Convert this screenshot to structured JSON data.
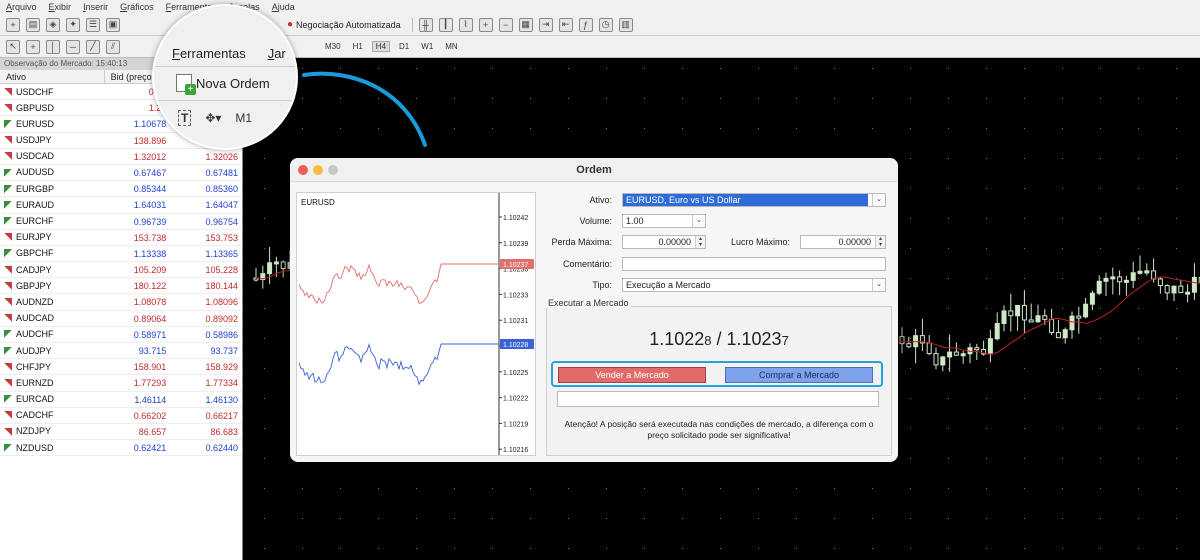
{
  "menu": [
    "Arquivo",
    "Exibir",
    "Inserir",
    "Gráficos",
    "Ferramentas",
    "Janelas",
    "Ajuda"
  ],
  "toolbar": {
    "algo_trading_label": "Negociação Automatizada"
  },
  "timeframes": [
    "M30",
    "H1",
    "H4",
    "D1",
    "W1",
    "MN"
  ],
  "selected_timeframe": "H4",
  "market_watch": {
    "title": "Observação do Mercado: 15:40:13",
    "col_symbol": "Ativo",
    "col_bid": "Bid (preço ...",
    "rows": [
      {
        "symbol": "USDCHF",
        "bid": "0.87",
        "ask": "",
        "dir": "down"
      },
      {
        "symbol": "GBPUSD",
        "bid": "1.29",
        "ask": "",
        "dir": "down"
      },
      {
        "symbol": "EURUSD",
        "bid": "1.10678",
        "ask": "",
        "dir": "up"
      },
      {
        "symbol": "USDJPY",
        "bid": "138.896",
        "ask": "",
        "dir": "down"
      },
      {
        "symbol": "USDCAD",
        "bid": "1.32012",
        "ask": "1.32026",
        "dir": "down"
      },
      {
        "symbol": "AUDUSD",
        "bid": "0.67467",
        "ask": "0.67481",
        "dir": "up"
      },
      {
        "symbol": "EURGBP",
        "bid": "0.85344",
        "ask": "0.85360",
        "dir": "up"
      },
      {
        "symbol": "EURAUD",
        "bid": "1.64031",
        "ask": "1.64047",
        "dir": "up"
      },
      {
        "symbol": "EURCHF",
        "bid": "0.96739",
        "ask": "0.96754",
        "dir": "up"
      },
      {
        "symbol": "EURJPY",
        "bid": "153.738",
        "ask": "153.753",
        "dir": "down"
      },
      {
        "symbol": "GBPCHF",
        "bid": "1.13338",
        "ask": "1.13365",
        "dir": "up"
      },
      {
        "symbol": "CADJPY",
        "bid": "105.209",
        "ask": "105.228",
        "dir": "down"
      },
      {
        "symbol": "GBPJPY",
        "bid": "180.122",
        "ask": "180.144",
        "dir": "down"
      },
      {
        "symbol": "AUDNZD",
        "bid": "1.08078",
        "ask": "1.08096",
        "dir": "down"
      },
      {
        "symbol": "AUDCAD",
        "bid": "0.89064",
        "ask": "0.89092",
        "dir": "down"
      },
      {
        "symbol": "AUDCHF",
        "bid": "0.58971",
        "ask": "0.58986",
        "dir": "up"
      },
      {
        "symbol": "AUDJPY",
        "bid": "93.715",
        "ask": "93.737",
        "dir": "up"
      },
      {
        "symbol": "CHFJPY",
        "bid": "158.901",
        "ask": "158.929",
        "dir": "down"
      },
      {
        "symbol": "EURNZD",
        "bid": "1.77293",
        "ask": "1.77334",
        "dir": "down"
      },
      {
        "symbol": "EURCAD",
        "bid": "1.46114",
        "ask": "1.46130",
        "dir": "up"
      },
      {
        "symbol": "CADCHF",
        "bid": "0.66202",
        "ask": "0.66217",
        "dir": "down"
      },
      {
        "symbol": "NZDJPY",
        "bid": "86.657",
        "ask": "86.683",
        "dir": "down"
      },
      {
        "symbol": "NZDUSD",
        "bid": "0.62421",
        "ask": "0.62440",
        "dir": "up"
      }
    ]
  },
  "zoom": {
    "menu_tools": "Ferramentas",
    "menu_windows": "Jar",
    "new_order": "Nova Ordem",
    "timeframe": "M1"
  },
  "dialog": {
    "title": "Ordem",
    "chart_symbol": "EURUSD",
    "price_ticks": [
      "1.10242",
      "1.10239",
      "1.10236",
      "1.10233",
      "1.10231",
      "1.10228",
      "1.10225",
      "1.10222",
      "1.10219",
      "1.10216"
    ],
    "ask_tag": "1.10237",
    "bid_tag": "1.10228",
    "labels": {
      "symbol": "Ativo:",
      "volume": "Volume:",
      "stop_loss": "Perda Máxima:",
      "take_profit": "Lucro Máximo:",
      "comment": "Comentário:",
      "type": "Tipo:"
    },
    "values": {
      "symbol": "EURUSD, Euro vs US Dollar",
      "volume": "1.00",
      "stop_loss": "0.00000",
      "take_profit": "0.00000",
      "comment": "",
      "type": "Execução a Mercado"
    },
    "exec_group": "Executar a Mercado",
    "bid_main": "1.1022",
    "bid_small": "8",
    "price_sep": " / ",
    "ask_main": "1.1023",
    "ask_small": "7",
    "sell_button": "Vender a Mercado",
    "buy_button": "Comprar a Mercado",
    "warning": "Atenção! A posição será executada nas condições de mercado, a diferença com o preço solicitado pode ser significativa!"
  },
  "colors": {
    "bid_series": "#e0706a",
    "ask_series": "#3a62d6",
    "highlight_ring": "#2aa0d8",
    "candle_color": "#cfe8c8"
  }
}
